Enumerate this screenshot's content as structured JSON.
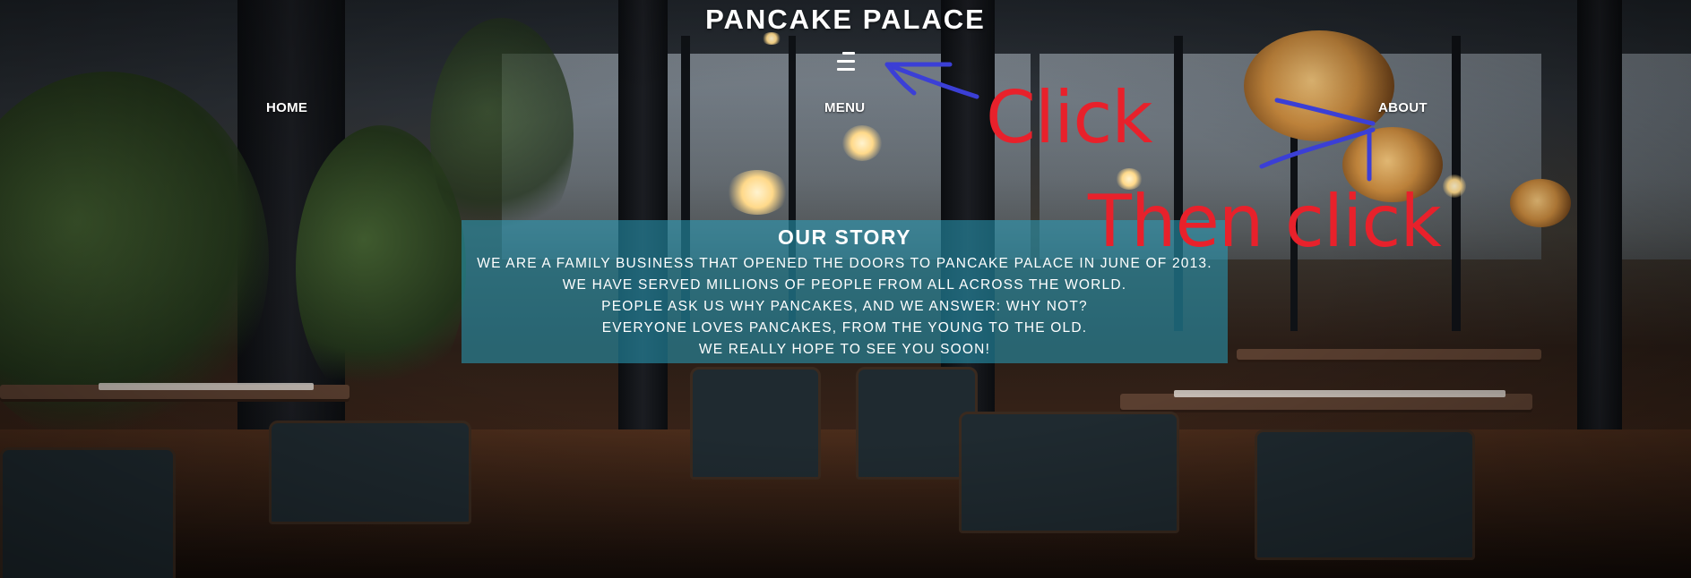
{
  "site": {
    "title": "PANCAKE PALACE",
    "nav": {
      "menu_icon": "hamburger-menu-icon",
      "home": "HOME",
      "menu": "MENU",
      "about": "ABOUT"
    }
  },
  "story": {
    "heading": "OUR STORY",
    "lines": [
      "WE ARE A FAMILY BUSINESS THAT OPENED THE DOORS TO PANCAKE PALACE IN JUNE OF 2013.",
      "WE HAVE SERVED MILLIONS OF PEOPLE FROM ALL ACROSS THE WORLD.",
      "PEOPLE ASK US WHY PANCAKES, AND WE ANSWER: WHY NOT?",
      "EVERYONE LOVES PANCAKES, FROM THE YOUNG TO THE OLD.",
      "WE REALLY HOPE TO SEE YOU SOON!"
    ]
  },
  "annotations": {
    "first": "Click",
    "second": "Then click",
    "text_color": "#e8212b",
    "arrow_color": "#3b3fd6"
  },
  "colors": {
    "story_box_bg": "rgba(40,160,190,0.55)",
    "text": "#ffffff"
  }
}
